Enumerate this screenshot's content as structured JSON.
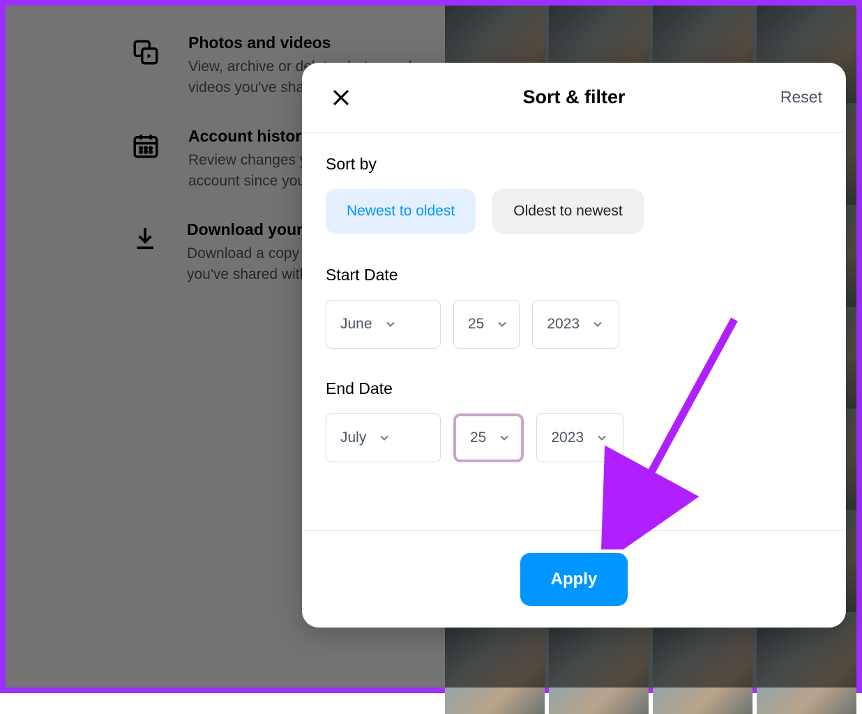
{
  "background": {
    "items": [
      {
        "title": "Photos and videos",
        "desc": "View, archive or delete photos and videos you've shared."
      },
      {
        "title": "Account history",
        "desc": "Review changes you've made to your account since you created it."
      },
      {
        "title": "Download your information",
        "desc": "Download a copy of the information you've shared with Instagram."
      }
    ]
  },
  "modal": {
    "title": "Sort & filter",
    "reset": "Reset",
    "sort_label": "Sort by",
    "sort_options": {
      "newest": "Newest to oldest",
      "oldest": "Oldest to newest"
    },
    "start_label": "Start Date",
    "start": {
      "month": "June",
      "day": "25",
      "year": "2023"
    },
    "end_label": "End Date",
    "end": {
      "month": "July",
      "day": "25",
      "year": "2023"
    },
    "apply": "Apply"
  }
}
